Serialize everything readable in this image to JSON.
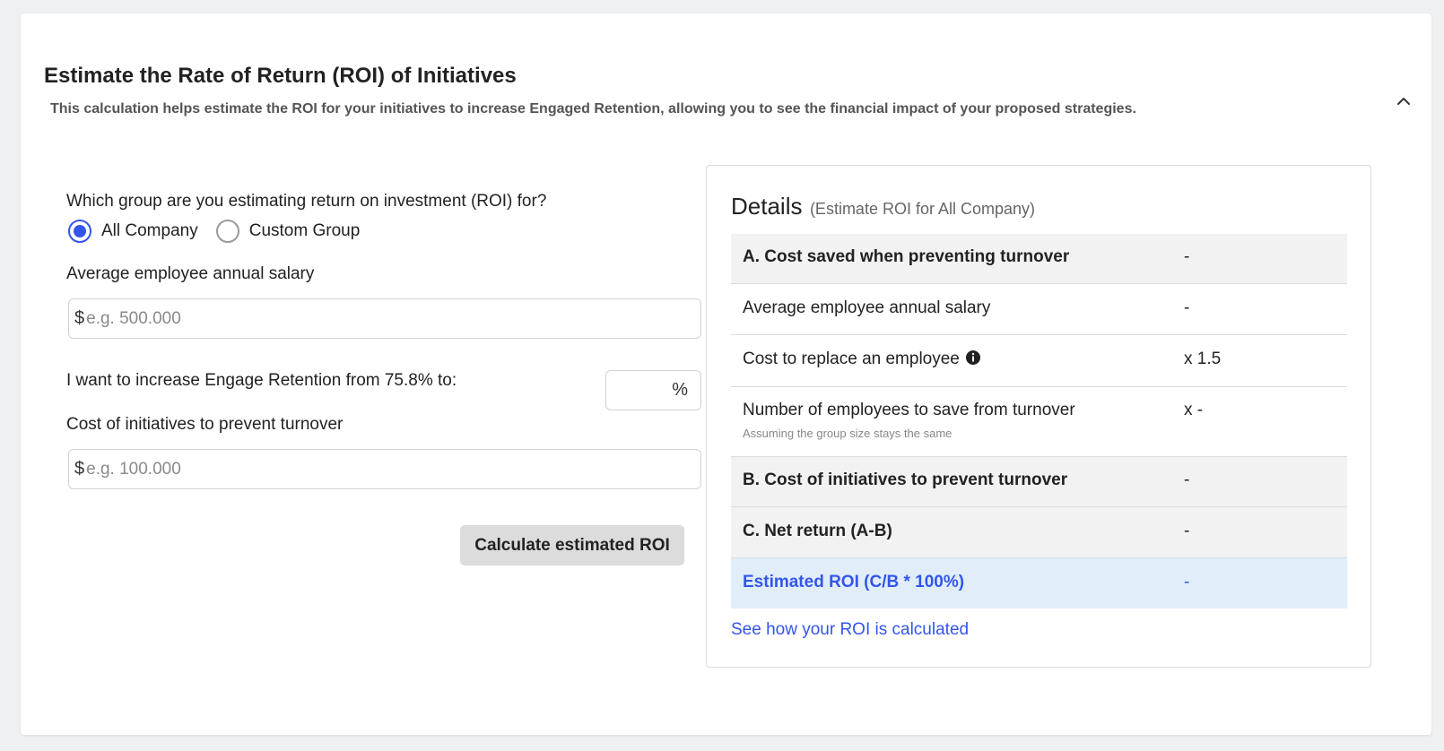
{
  "header": {
    "title": "Estimate the Rate of Return (ROI) of Initiatives",
    "subtitle": "This calculation helps estimate the ROI for your initiatives to increase Engaged Retention, allowing you to see the financial impact of your proposed strategies."
  },
  "form": {
    "group_question": "Which group are you estimating return on investment (ROI) for?",
    "group_options": [
      {
        "label": "All Company",
        "selected": true
      },
      {
        "label": "Custom Group",
        "selected": false
      }
    ],
    "salary_label": "Average employee annual salary",
    "salary_currency": "$",
    "salary_placeholder": "e.g. 500.000",
    "retention_label": "I want to increase Engage Retention from 75.8% to:",
    "retention_unit": "%",
    "cost_label": "Cost of initiatives to prevent turnover",
    "cost_currency": "$",
    "cost_placeholder": "e.g. 100.000",
    "calculate_button": "Calculate estimated ROI"
  },
  "details": {
    "title": "Details",
    "subtitle": "(Estimate ROI for All Company)",
    "rows": [
      {
        "label": "A. Cost saved when preventing turnover",
        "value": "-"
      },
      {
        "label": "Average employee annual salary",
        "value": "-"
      },
      {
        "label": "Cost to replace an employee",
        "value": "x 1.5"
      },
      {
        "label": "Number of employees to save from turnover",
        "value": "x -",
        "note": "Assuming the group size stays the same"
      },
      {
        "label": "B. Cost of initiatives to prevent turnover",
        "value": "-"
      },
      {
        "label": "C. Net return (A-B)",
        "value": "-"
      },
      {
        "label": "Estimated ROI (C/B * 100%)",
        "value": "-"
      }
    ],
    "link": "See how your ROI is calculated"
  },
  "colors": {
    "accent": "#3355ee",
    "highlight_row": "#e1eefa",
    "shaded_row": "#f2f2f2"
  }
}
